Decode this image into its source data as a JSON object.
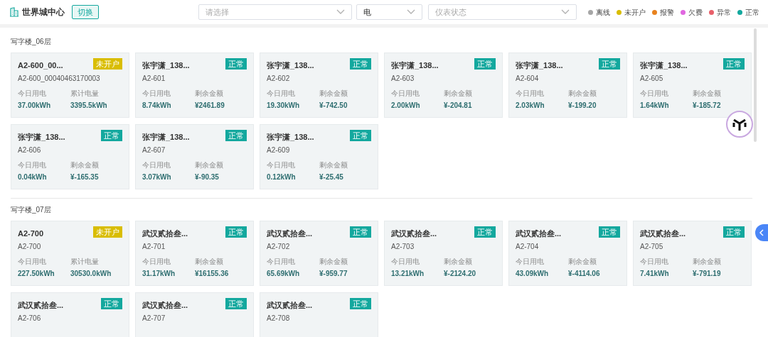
{
  "header": {
    "title": "世界城中心",
    "switch_button": "切换"
  },
  "filters": [
    {
      "placeholder": "请选择"
    },
    {
      "value": "电"
    },
    {
      "placeholder": "仪表状态"
    }
  ],
  "legend": [
    {
      "label": "离线",
      "color": "#a6a6a6"
    },
    {
      "label": "未开户",
      "color": "#d9bd00"
    },
    {
      "label": "报警",
      "color": "#e8821e"
    },
    {
      "label": "欠费",
      "color": "#e067e0"
    },
    {
      "label": "异常",
      "color": "#e8606a"
    },
    {
      "label": "正常",
      "color": "#13a89e"
    }
  ],
  "sections": [
    {
      "title": "写字楼_06层",
      "cards": [
        {
          "name": "A2-600_00...",
          "code": "A2-600_00040463170003",
          "status": {
            "text": "未开户",
            "color": "#d9bd00"
          },
          "metrics": [
            {
              "label": "今日用电",
              "value": "37.00kWh"
            },
            {
              "label": "累计电量",
              "value": "3395.5kWh"
            }
          ]
        },
        {
          "name": "张宇潇_138...",
          "code": "A2-601",
          "status": {
            "text": "正常",
            "color": "#13a89e"
          },
          "metrics": [
            {
              "label": "今日用电",
              "value": "8.74kWh"
            },
            {
              "label": "剩余金额",
              "value": "¥2461.89"
            }
          ]
        },
        {
          "name": "张宇潇_138...",
          "code": "A2-602",
          "status": {
            "text": "正常",
            "color": "#13a89e"
          },
          "metrics": [
            {
              "label": "今日用电",
              "value": "19.30kWh"
            },
            {
              "label": "剩余金额",
              "value": "¥-742.50"
            }
          ]
        },
        {
          "name": "张宇潇_138...",
          "code": "A2-603",
          "status": {
            "text": "正常",
            "color": "#13a89e"
          },
          "metrics": [
            {
              "label": "今日用电",
              "value": "2.00kWh"
            },
            {
              "label": "剩余金额",
              "value": "¥-204.81"
            }
          ]
        },
        {
          "name": "张宇潇_138...",
          "code": "A2-604",
          "status": {
            "text": "正常",
            "color": "#13a89e"
          },
          "metrics": [
            {
              "label": "今日用电",
              "value": "2.03kWh"
            },
            {
              "label": "剩余金额",
              "value": "¥-199.20"
            }
          ]
        },
        {
          "name": "张宇潇_138...",
          "code": "A2-605",
          "status": {
            "text": "正常",
            "color": "#13a89e"
          },
          "metrics": [
            {
              "label": "今日用电",
              "value": "1.64kWh"
            },
            {
              "label": "剩余金额",
              "value": "¥-185.72"
            }
          ]
        },
        {
          "name": "张宇潇_138...",
          "code": "A2-606",
          "status": {
            "text": "正常",
            "color": "#13a89e"
          },
          "metrics": [
            {
              "label": "今日用电",
              "value": "0.04kWh"
            },
            {
              "label": "剩余金额",
              "value": "¥-165.35"
            }
          ]
        },
        {
          "name": "张宇潇_138...",
          "code": "A2-607",
          "status": {
            "text": "正常",
            "color": "#13a89e"
          },
          "metrics": [
            {
              "label": "今日用电",
              "value": "3.07kWh"
            },
            {
              "label": "剩余金额",
              "value": "¥-90.35"
            }
          ]
        },
        {
          "name": "张宇潇_138...",
          "code": "A2-609",
          "status": {
            "text": "正常",
            "color": "#13a89e"
          },
          "metrics": [
            {
              "label": "今日用电",
              "value": "0.12kWh"
            },
            {
              "label": "剩余金额",
              "value": "¥-25.45"
            }
          ]
        }
      ]
    },
    {
      "title": "写字楼_07层",
      "cards": [
        {
          "name": "A2-700",
          "code": "A2-700",
          "status": {
            "text": "未开户",
            "color": "#d9bd00"
          },
          "metrics": [
            {
              "label": "今日用电",
              "value": "227.50kWh"
            },
            {
              "label": "累计电量",
              "value": "30530.0kWh"
            }
          ]
        },
        {
          "name": "武汉贰拾叁...",
          "code": "A2-701",
          "status": {
            "text": "正常",
            "color": "#13a89e"
          },
          "metrics": [
            {
              "label": "今日用电",
              "value": "31.17kWh"
            },
            {
              "label": "剩余金额",
              "value": "¥16155.36"
            }
          ]
        },
        {
          "name": "武汉贰拾叁...",
          "code": "A2-702",
          "status": {
            "text": "正常",
            "color": "#13a89e"
          },
          "metrics": [
            {
              "label": "今日用电",
              "value": "65.69kWh"
            },
            {
              "label": "剩余金额",
              "value": "¥-959.77"
            }
          ]
        },
        {
          "name": "武汉贰拾叁...",
          "code": "A2-703",
          "status": {
            "text": "正常",
            "color": "#13a89e"
          },
          "metrics": [
            {
              "label": "今日用电",
              "value": "13.21kWh"
            },
            {
              "label": "剩余金额",
              "value": "¥-2124.20"
            }
          ]
        },
        {
          "name": "武汉贰拾叁...",
          "code": "A2-704",
          "status": {
            "text": "正常",
            "color": "#13a89e"
          },
          "metrics": [
            {
              "label": "今日用电",
              "value": "43.09kWh"
            },
            {
              "label": "剩余金额",
              "value": "¥-4114.06"
            }
          ]
        },
        {
          "name": "武汉贰拾叁...",
          "code": "A2-705",
          "status": {
            "text": "正常",
            "color": "#13a89e"
          },
          "metrics": [
            {
              "label": "今日用电",
              "value": "7.41kWh"
            },
            {
              "label": "剩余金额",
              "value": "¥-791.19"
            }
          ]
        },
        {
          "name": "武汉贰拾叁...",
          "code": "A2-706",
          "status": {
            "text": "正常",
            "color": "#13a89e"
          }
        },
        {
          "name": "武汉贰拾叁...",
          "code": "A2-707",
          "status": {
            "text": "正常",
            "color": "#13a89e"
          }
        },
        {
          "name": "武汉贰拾叁...",
          "code": "A2-708",
          "status": {
            "text": "正常",
            "color": "#13a89e"
          }
        }
      ]
    }
  ]
}
